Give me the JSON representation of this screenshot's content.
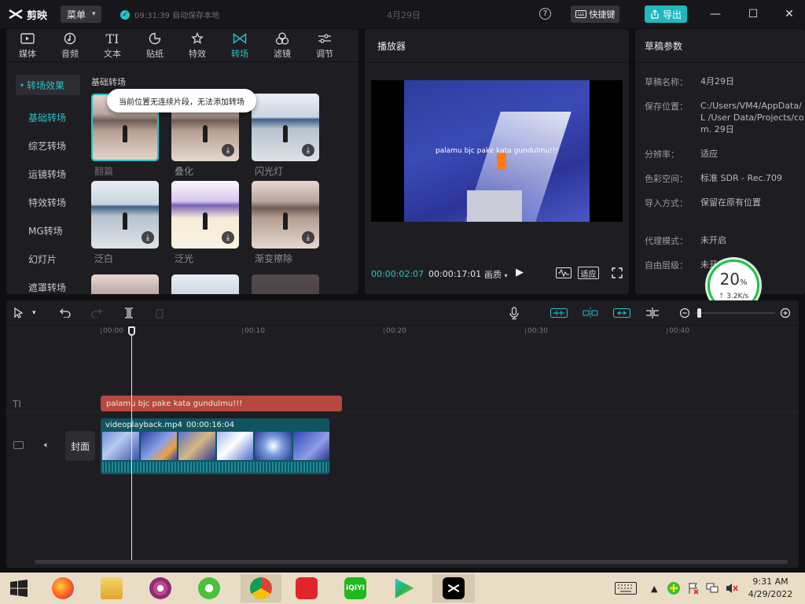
{
  "titlebar": {
    "app_name": "剪映",
    "menu_label": "菜单",
    "save_status": "09:31:39 自动保存本地",
    "project_title": "4月29日",
    "help_symbol": "?",
    "shortcut_label": "快捷键",
    "export_label": "导出"
  },
  "media_tabs": [
    {
      "label": "媒体",
      "icon": "media-icon"
    },
    {
      "label": "音频",
      "icon": "audio-icon"
    },
    {
      "label": "文本",
      "icon": "text-icon"
    },
    {
      "label": "贴纸",
      "icon": "sticker-icon"
    },
    {
      "label": "特效",
      "icon": "effects-icon"
    },
    {
      "label": "转场",
      "icon": "transition-icon",
      "active": true
    },
    {
      "label": "滤镜",
      "icon": "filter-icon"
    },
    {
      "label": "调节",
      "icon": "adjust-icon"
    }
  ],
  "categories": {
    "header": "转场效果",
    "items": [
      "基础转场",
      "综艺转场",
      "运镜转场",
      "特效转场",
      "MG转场",
      "幻灯片",
      "遮罩转场"
    ],
    "active_index": 0
  },
  "transitions": {
    "section_title": "基础转场",
    "tooltip": "当前位置无连续片段，无法添加转场",
    "items": [
      {
        "label": "翻篇"
      },
      {
        "label": "叠化"
      },
      {
        "label": "闪光灯"
      },
      {
        "label": "泛白"
      },
      {
        "label": "泛光"
      },
      {
        "label": "渐变擦除"
      }
    ]
  },
  "player": {
    "title": "播放器",
    "caption": "palamu bjc pake kata gundulmu!!!",
    "current_time": "00:00:02:07",
    "total_time": "00:00:17:01",
    "quality_label": "画质",
    "fit_label": "适应"
  },
  "properties": {
    "title": "草稿参数",
    "rows": [
      {
        "label": "草稿名称：",
        "value": "4月29日"
      },
      {
        "label": "保存位置：",
        "value": "C:/Users/VM4/AppData/L /User Data/Projects/com. 29日"
      },
      {
        "label": "分辨率：",
        "value": "适应"
      },
      {
        "label": "色彩空间：",
        "value": "标准 SDR - Rec.709"
      },
      {
        "label": "导入方式：",
        "value": "保留在原有位置"
      },
      {
        "label": "代理模式：",
        "value": "未开启"
      },
      {
        "label": "自由层级：",
        "value": "未开启"
      }
    ]
  },
  "speed_widget": {
    "percent": "20",
    "percent_sign": "%",
    "rate": "3.2K/s",
    "arrow": "↑"
  },
  "timeline": {
    "ruler_labels": [
      "00:00",
      "00:10",
      "00:20",
      "00:30",
      "00:40"
    ],
    "text_track_icon": "TI",
    "text_clip": "palamu bjc pake kata gundulmu!!!",
    "cover_label": "封面",
    "video_clip_name": "videoplayback.mp4",
    "video_clip_duration": "00:00:16:04"
  },
  "taskbar": {
    "apps": [
      "firefox",
      "file-explorer",
      "media-player",
      "360-browser",
      "chrome",
      "netease-music",
      "iqiyi",
      "video-player",
      "capcut"
    ],
    "time": "9:31 AM",
    "date": "4/29/2022"
  },
  "colors": {
    "accent": "#26c3c6",
    "text_clip": "#b5493f",
    "video_clip": "#0f5560"
  }
}
